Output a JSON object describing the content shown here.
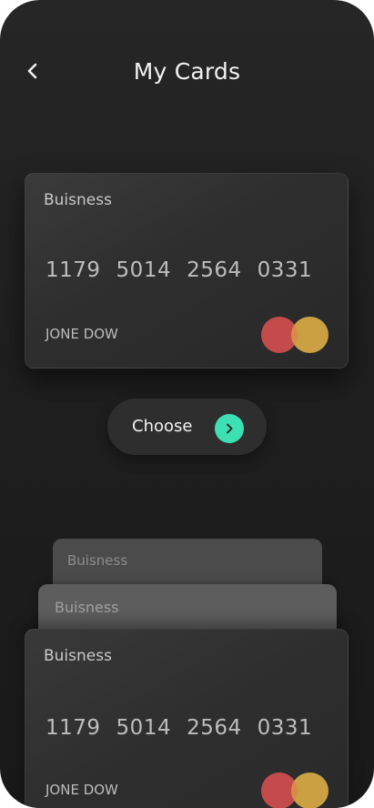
{
  "header": {
    "title": "My Cards"
  },
  "selected_card": {
    "type": "Buisness",
    "number_groups": [
      "1179",
      "5014",
      "2564",
      "0331"
    ],
    "holder": "JONE DOW"
  },
  "choose_button": {
    "label": "Choose"
  },
  "card_stack": [
    {
      "type": "Buisness"
    },
    {
      "type": "Buisness"
    },
    {
      "type": "Buisness",
      "number_groups": [
        "1179",
        "5014",
        "2564",
        "0331"
      ],
      "holder": "JONE DOW"
    }
  ],
  "colors": {
    "background": "#222222",
    "card": "#2f2f2f",
    "accent": "#3de0b2",
    "mastercard_red": "#c44b4b",
    "mastercard_yellow": "#d0a444"
  },
  "icons": {
    "back": "chevron-left-icon",
    "choose": "chevron-right-icon",
    "card_brand": "mastercard-logo-icon"
  }
}
